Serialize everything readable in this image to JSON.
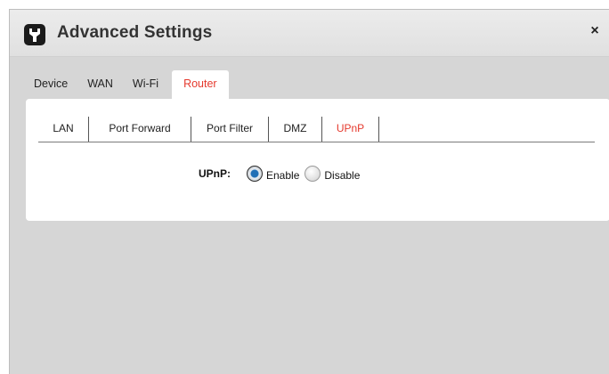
{
  "dialog": {
    "title": "Advanced Settings",
    "close_glyph": "×",
    "title_icon": "wrench-icon"
  },
  "main_tabs": [
    {
      "label": "Device"
    },
    {
      "label": "WAN"
    },
    {
      "label": "Wi-Fi"
    },
    {
      "label": "Router",
      "active": true
    }
  ],
  "sub_tabs": [
    {
      "label": "LAN"
    },
    {
      "label": "Port Forward"
    },
    {
      "label": "Port Filter"
    },
    {
      "label": "DMZ"
    },
    {
      "label": "UPnP",
      "active": true
    }
  ],
  "upnp": {
    "label": "UPnP:",
    "options": [
      {
        "label": "Enable",
        "checked": true
      },
      {
        "label": "Disable",
        "checked": false
      }
    ]
  },
  "colors": {
    "accent": "#e5392d",
    "background": "#d6d6d6",
    "panel": "#ffffff"
  }
}
